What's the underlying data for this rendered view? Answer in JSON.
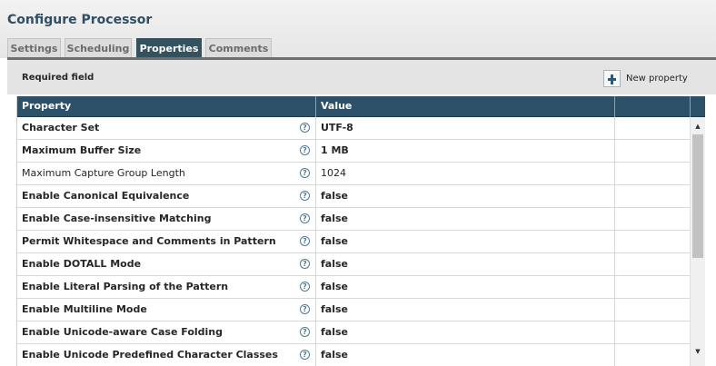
{
  "dialog": {
    "title": "Configure Processor"
  },
  "tabs": [
    {
      "label": "Settings"
    },
    {
      "label": "Scheduling"
    },
    {
      "label": "Properties"
    },
    {
      "label": "Comments"
    }
  ],
  "active_tab": "Properties",
  "toolbar": {
    "required_label": "Required field",
    "new_property_label": "New property"
  },
  "grid": {
    "columns": [
      "Property",
      "Value",
      ""
    ],
    "rows": [
      {
        "name": "Character Set",
        "value": "UTF-8",
        "required": true
      },
      {
        "name": "Maximum Buffer Size",
        "value": "1 MB",
        "required": true
      },
      {
        "name": "Maximum Capture Group Length",
        "value": "1024",
        "required": false
      },
      {
        "name": "Enable Canonical Equivalence",
        "value": "false",
        "required": true
      },
      {
        "name": "Enable Case-insensitive Matching",
        "value": "false",
        "required": true
      },
      {
        "name": "Permit Whitespace and Comments in Pattern",
        "value": "false",
        "required": true
      },
      {
        "name": "Enable DOTALL Mode",
        "value": "false",
        "required": true
      },
      {
        "name": "Enable Literal Parsing of the Pattern",
        "value": "false",
        "required": true
      },
      {
        "name": "Enable Multiline Mode",
        "value": "false",
        "required": true
      },
      {
        "name": "Enable Unicode-aware Case Folding",
        "value": "false",
        "required": true
      },
      {
        "name": "Enable Unicode Predefined Character Classes",
        "value": "false",
        "required": true
      }
    ]
  },
  "icons": {
    "help": "help-icon",
    "add": "plus-icon",
    "scroll_up": "scroll-up-icon",
    "scroll_down": "scroll-down-icon"
  },
  "colors": {
    "header_bg": "#2d5169",
    "active_tab_bg": "#34515e",
    "title_color": "#2f4f66"
  }
}
